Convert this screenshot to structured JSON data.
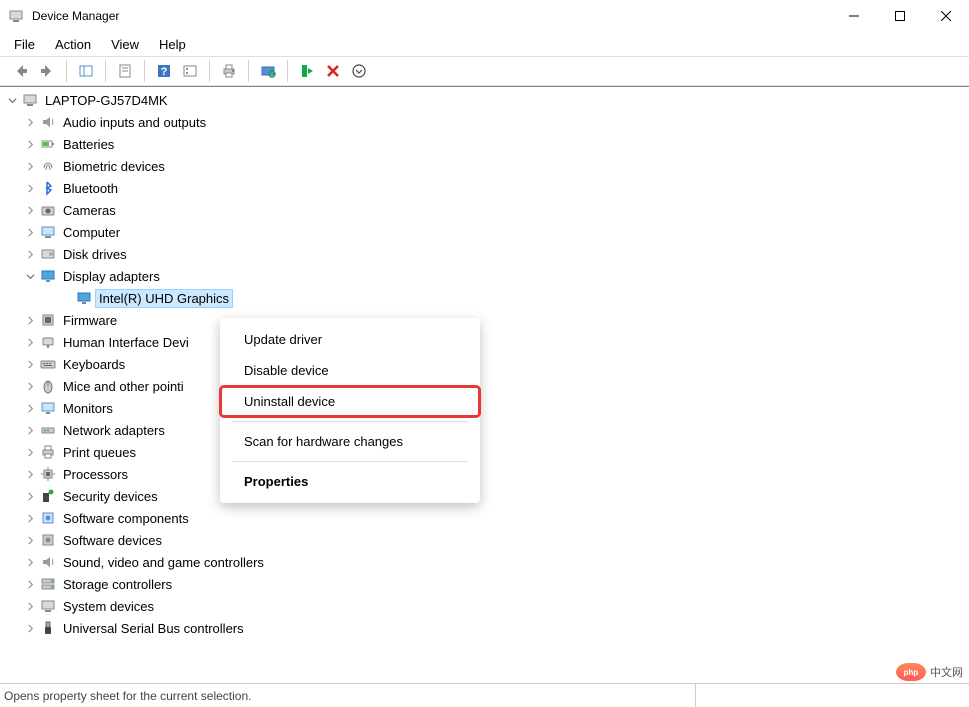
{
  "title": "Device Manager",
  "menu": {
    "file": "File",
    "action": "Action",
    "view": "View",
    "help": "Help"
  },
  "root": "LAPTOP-GJ57D4MK",
  "categories": [
    {
      "label": "Audio inputs and outputs",
      "icon": "speaker"
    },
    {
      "label": "Batteries",
      "icon": "battery"
    },
    {
      "label": "Biometric devices",
      "icon": "fingerprint"
    },
    {
      "label": "Bluetooth",
      "icon": "bluetooth"
    },
    {
      "label": "Cameras",
      "icon": "camera"
    },
    {
      "label": "Computer",
      "icon": "computer"
    },
    {
      "label": "Disk drives",
      "icon": "disk"
    },
    {
      "label": "Display adapters",
      "icon": "display",
      "expanded": true,
      "children": [
        {
          "label": "Intel(R) UHD Graphics",
          "icon": "display",
          "selected": true
        }
      ]
    },
    {
      "label": "Firmware",
      "icon": "firmware"
    },
    {
      "label": "Human Interface Devi",
      "icon": "hid",
      "truncated": true
    },
    {
      "label": "Keyboards",
      "icon": "keyboard"
    },
    {
      "label": "Mice and other pointi",
      "icon": "mouse",
      "truncated": true
    },
    {
      "label": "Monitors",
      "icon": "monitor"
    },
    {
      "label": "Network adapters",
      "icon": "network"
    },
    {
      "label": "Print queues",
      "icon": "printer"
    },
    {
      "label": "Processors",
      "icon": "cpu"
    },
    {
      "label": "Security devices",
      "icon": "security"
    },
    {
      "label": "Software components",
      "icon": "swcomp"
    },
    {
      "label": "Software devices",
      "icon": "swdev"
    },
    {
      "label": "Sound, video and game controllers",
      "icon": "speaker"
    },
    {
      "label": "Storage controllers",
      "icon": "storage"
    },
    {
      "label": "System devices",
      "icon": "system"
    },
    {
      "label": "Universal Serial Bus controllers",
      "icon": "usb"
    }
  ],
  "context_menu": {
    "update": "Update driver",
    "disable": "Disable device",
    "uninstall": "Uninstall device",
    "scan": "Scan for hardware changes",
    "properties": "Properties"
  },
  "statusbar": "Opens property sheet for the current selection.",
  "watermark": "中文网"
}
